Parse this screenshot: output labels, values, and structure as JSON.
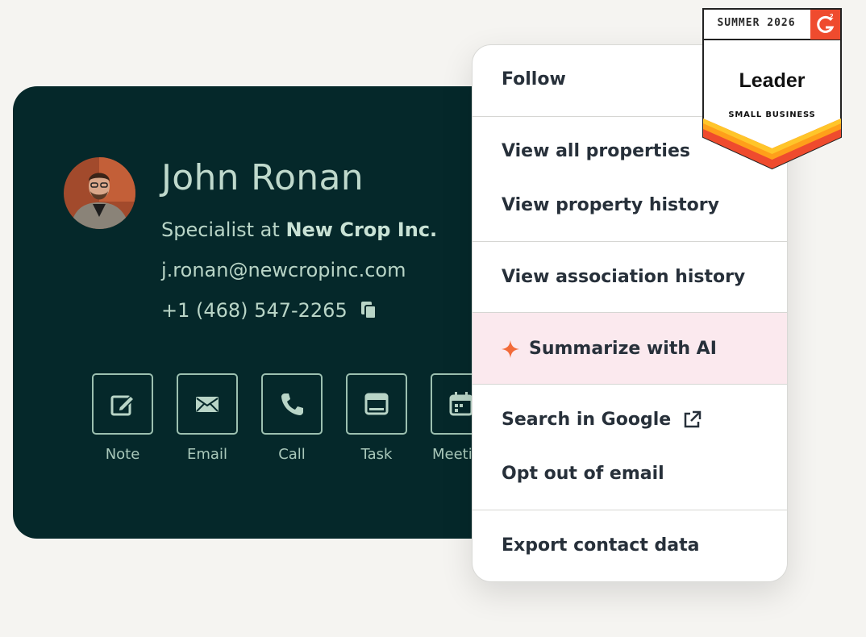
{
  "contact": {
    "name": "John Ronan",
    "role_prefix": "Specialist at ",
    "company": "New Crop Inc.",
    "email": "j.ronan@newcropinc.com",
    "phone": "+1 (468) 547-2265",
    "avatar_icon": "profile-photo",
    "copy_icon": "copy-icon"
  },
  "actions": [
    {
      "label": "Note",
      "icon": "note-icon"
    },
    {
      "label": "Email",
      "icon": "email-icon"
    },
    {
      "label": "Call",
      "icon": "call-icon"
    },
    {
      "label": "Task",
      "icon": "task-icon"
    },
    {
      "label": "Meeti",
      "icon": "meeting-icon"
    }
  ],
  "menu": {
    "items": [
      {
        "label": "Follow"
      },
      {
        "label": "View all properties"
      },
      {
        "label": "View property history"
      },
      {
        "label": "View association history"
      },
      {
        "label": "Summarize with AI",
        "icon": "sparkle-icon"
      },
      {
        "label": "Search in Google",
        "icon": "external-link-icon"
      },
      {
        "label": "Opt out of email"
      },
      {
        "label": "Export contact data"
      }
    ]
  },
  "badge": {
    "season": "SUMMER 2026",
    "title": "Leader",
    "subtitle": "SMALL BUSINESS",
    "logo": "G2"
  },
  "colors": {
    "card_bg": "#05282a",
    "card_text": "#b9d5c7",
    "page_bg": "#f5f4f1",
    "ai_highlight": "#fbe9ee",
    "sparkle": "#f26b3a",
    "badge_red": "#ef4b2e",
    "badge_orange": "#ff9f1a",
    "badge_yellow": "#ffc52a"
  }
}
